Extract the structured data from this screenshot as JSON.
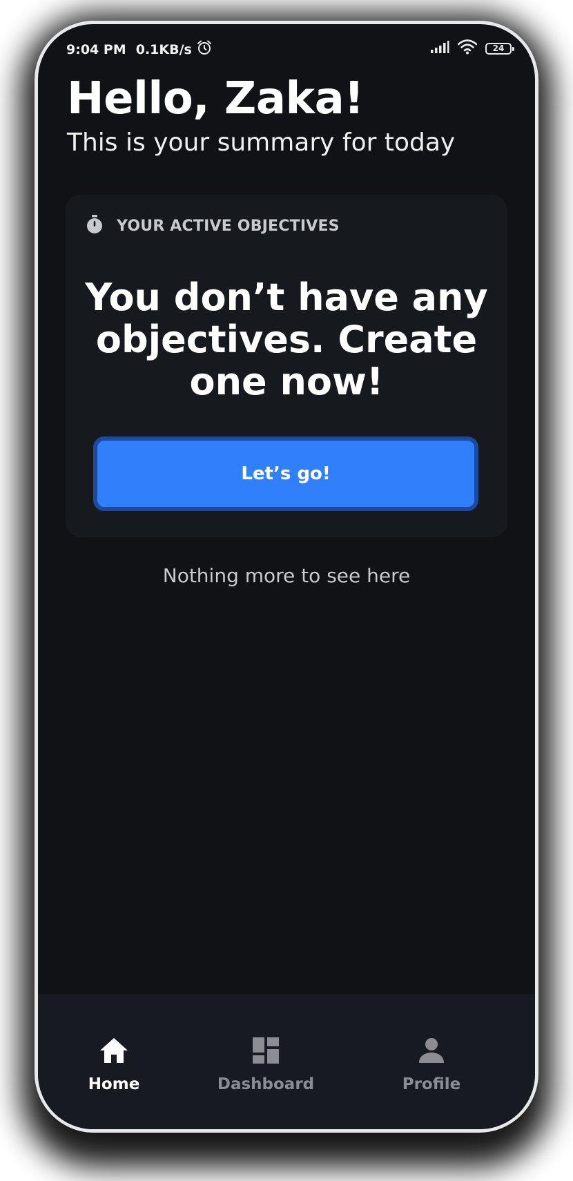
{
  "status_bar": {
    "time": "9:04 PM",
    "network_speed": "0.1KB/s",
    "battery_level": "24",
    "icons": [
      "alarm-icon",
      "signal-icon",
      "wifi-icon",
      "battery-icon"
    ]
  },
  "header": {
    "greeting": "Hello, Zaka!",
    "subtitle": "This is your summary for today"
  },
  "objectives_card": {
    "icon": "stopwatch-icon",
    "title": "YOUR ACTIVE OBJECTIVES",
    "empty_message": "You don’t have any objectives. Create one now!",
    "cta_label": "Let’s go!"
  },
  "footer_note": "Nothing more to see here",
  "bottom_nav": {
    "items": [
      {
        "label": "Home",
        "icon": "home-icon",
        "active": true
      },
      {
        "label": "Dashboard",
        "icon": "dashboard-icon",
        "active": false
      },
      {
        "label": "Profile",
        "icon": "person-icon",
        "active": false
      }
    ]
  },
  "colors": {
    "background": "#101216",
    "card": "#16191d",
    "accent": "#3080fb",
    "accent_border": "#1d4a9e",
    "nav_background": "#171a21",
    "nav_active": "#ffffff",
    "nav_inactive": "#8b8d92"
  }
}
